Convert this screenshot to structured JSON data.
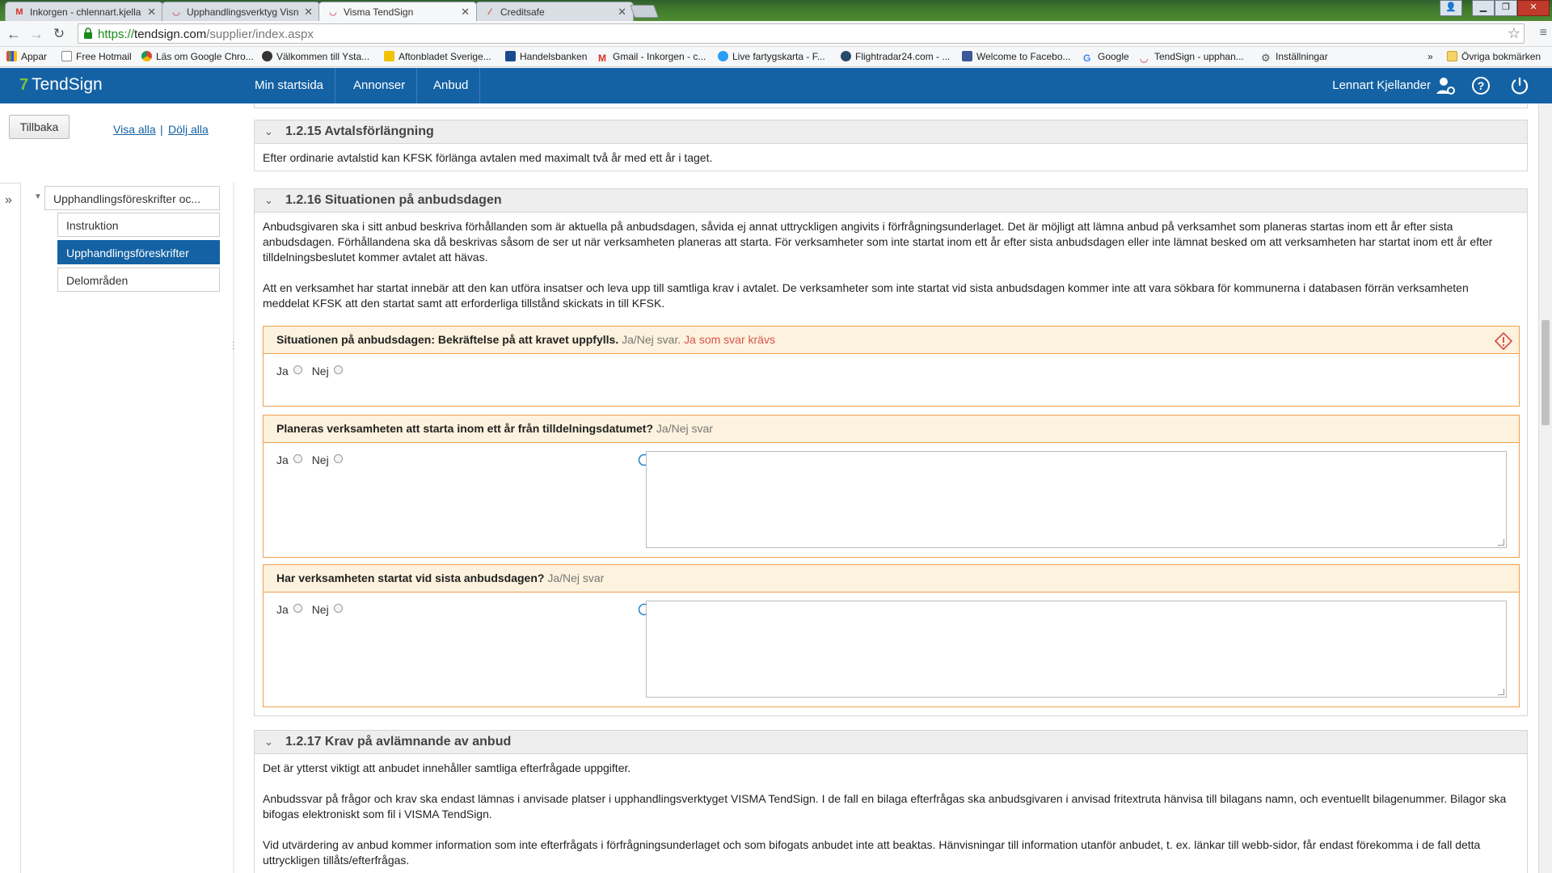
{
  "browser": {
    "tabs": [
      {
        "label": "Inkorgen - chlennart.kjella",
        "icon": "gmail-icon"
      },
      {
        "label": "Upphandlingsverktyg Visn",
        "icon": "visma-icon"
      },
      {
        "label": "Visma TendSign",
        "icon": "visma-icon"
      },
      {
        "label": "Creditsafe",
        "icon": "creditsafe-icon"
      }
    ],
    "url_proto": "https://",
    "url_host": "tendsign.com",
    "url_path": "/supplier/index.aspx",
    "bookmarks": [
      "Appar",
      "Free Hotmail",
      "Läs om Google Chro...",
      "Välkommen till Ysta...",
      "Aftonbladet Sverige...",
      "Handelsbanken",
      "Gmail - Inkorgen - c...",
      "Live fartygskarta - F...",
      "Flightradar24.com - ...",
      "Welcome to Facebo...",
      "Google",
      "TendSign - upphan...",
      "Inställningar"
    ],
    "bookmarks_overflow": "»",
    "other_bookmarks": "Övriga bokmärken"
  },
  "header": {
    "logo": "TendSign",
    "nav": [
      "Min startsida",
      "Annonser",
      "Anbud"
    ],
    "user": "Lennart Kjellander",
    "brand_color": "#1462a4"
  },
  "left": {
    "back": "Tillbaka",
    "show_all": "Visa alla",
    "separator": "|",
    "hide_all": "Dölj alla",
    "tree_root": "Upphandlingsföreskrifter oc...",
    "tree_items": [
      "Instruktion",
      "Upphandlingsföreskrifter",
      "Delområden"
    ],
    "selected_index": 1
  },
  "sections": {
    "s1": {
      "title": "1.2.15 Avtalsförlängning",
      "body": "Efter ordinarie avtalstid kan KFSK förlänga avtalen med maximalt två år med ett år i taget."
    },
    "s2": {
      "title": "1.2.16 Situationen på anbudsdagen",
      "p1": "Anbudsgivaren ska i sitt anbud beskriva förhållanden som är aktuella på anbudsdagen, såvida ej annat uttryckligen angivits i förfrågningsunderlaget.  Det är möjligt att lämna anbud på verksamhet som planeras startas inom ett år efter sista anbudsdagen. Förhållandena ska då beskrivas såsom de ser ut när verksamheten planeras att starta. För verksamheter som inte startat inom ett år efter sista anbudsdagen eller inte lämnat besked om att verksamheten har startat inom ett år efter tilldelningsbeslutet kommer avtalet att hävas.",
      "p2": "Att en verksamhet har startat innebär att den kan utföra insatser och leva upp till samtliga krav i avtalet. De verksamheter som inte startat vid sista anbudsdagen kommer inte att vara sökbara för kommunerna i databasen förrän verksamheten meddelat KFSK att den startat samt att erforderliga tillstånd skickats in till KFSK.",
      "q1": {
        "question": "Situationen på anbudsdagen: Bekräftelse på att kravet uppfylls.",
        "type": "Ja/Nej svar.",
        "warning": "Ja som svar krävs"
      },
      "q2": {
        "question": "Planeras verksamheten att starta inom ett år från tilldelningsdatumet?",
        "type": "Ja/Nej svar"
      },
      "q3": {
        "question": "Har verksamheten startat vid sista anbudsdagen?",
        "type": "Ja/Nej svar"
      },
      "yes": "Ja",
      "no": "Nej"
    },
    "s3": {
      "title": "1.2.17 Krav på avlämnande av anbud",
      "p1": "Det är ytterst viktigt att anbudet innehåller samtliga efterfrågade uppgifter.",
      "p2": "Anbudssvar på frågor och krav ska endast lämnas i anvisade platser i upphandlingsverktyget VISMA TendSign. I de fall en bilaga efterfrågas ska anbudsgivaren i anvisad fritextruta hänvisa till bilagans namn, och eventuellt bilagenummer. Bilagor ska bifogas elektroniskt som fil i VISMA TendSign.",
      "p3": "Vid utvärdering av anbud kommer information som inte efterfrågats i förfrågningsunderlaget och som bifogats anbudet inte att beaktas.  Hänvisningar till information utanför anbudet, t. ex. länkar till webb-sidor, får endast förekomma i de fall detta uttryckligen tillåts/efterfrågas."
    }
  }
}
